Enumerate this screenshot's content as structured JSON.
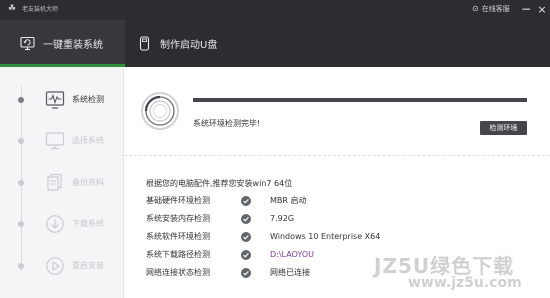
{
  "titlebar": {
    "logo_glyph": "☘",
    "app_title": "老友装机大师",
    "online_help": "在线客服",
    "help_icon_glyph": "⊙",
    "minimize_glyph": "−",
    "close_glyph": "×"
  },
  "tabs": [
    {
      "label": "一键重装系统",
      "active": true,
      "icon": "monitor-refresh-icon"
    },
    {
      "label": "制作启动U盘",
      "active": false,
      "icon": "usb-drive-icon"
    }
  ],
  "steps": [
    {
      "label": "系统检测",
      "active": true,
      "icon": "pulse-monitor-icon"
    },
    {
      "label": "选择系统",
      "active": false,
      "icon": "desktop-icon"
    },
    {
      "label": "备份资料",
      "active": false,
      "icon": "documents-icon"
    },
    {
      "label": "下载系统",
      "active": false,
      "icon": "download-icon"
    },
    {
      "label": "重启安装",
      "active": false,
      "icon": "restart-icon"
    }
  ],
  "detection": {
    "progress": 1.0,
    "status": "系统环境检测完毕!",
    "button_label": "检测环境"
  },
  "recommendation": "根据您的电脑配件,推荐您安装win7 64位",
  "info_rows": [
    {
      "label": "基础硬件环境检测",
      "value": "MBR 启动"
    },
    {
      "label": "系统安装内存检测",
      "value": "7.92G"
    },
    {
      "label": "系统软件环境检测",
      "value": "Windows 10 Enterprise X64"
    },
    {
      "label": "系统下载路径检测",
      "value": "D:\\LAOYOU"
    },
    {
      "label": "网络连接状态检测",
      "value": "网络已连接"
    }
  ],
  "watermark": {
    "line1": "JZ5U绿色下载",
    "line2": "www.jz5u.com"
  },
  "colors": {
    "titlebar_bg": "#2b2d30",
    "active_tab_underline": "#2f8f3f",
    "button_bg": "#43474b",
    "path_text": "#7a3f9a"
  }
}
